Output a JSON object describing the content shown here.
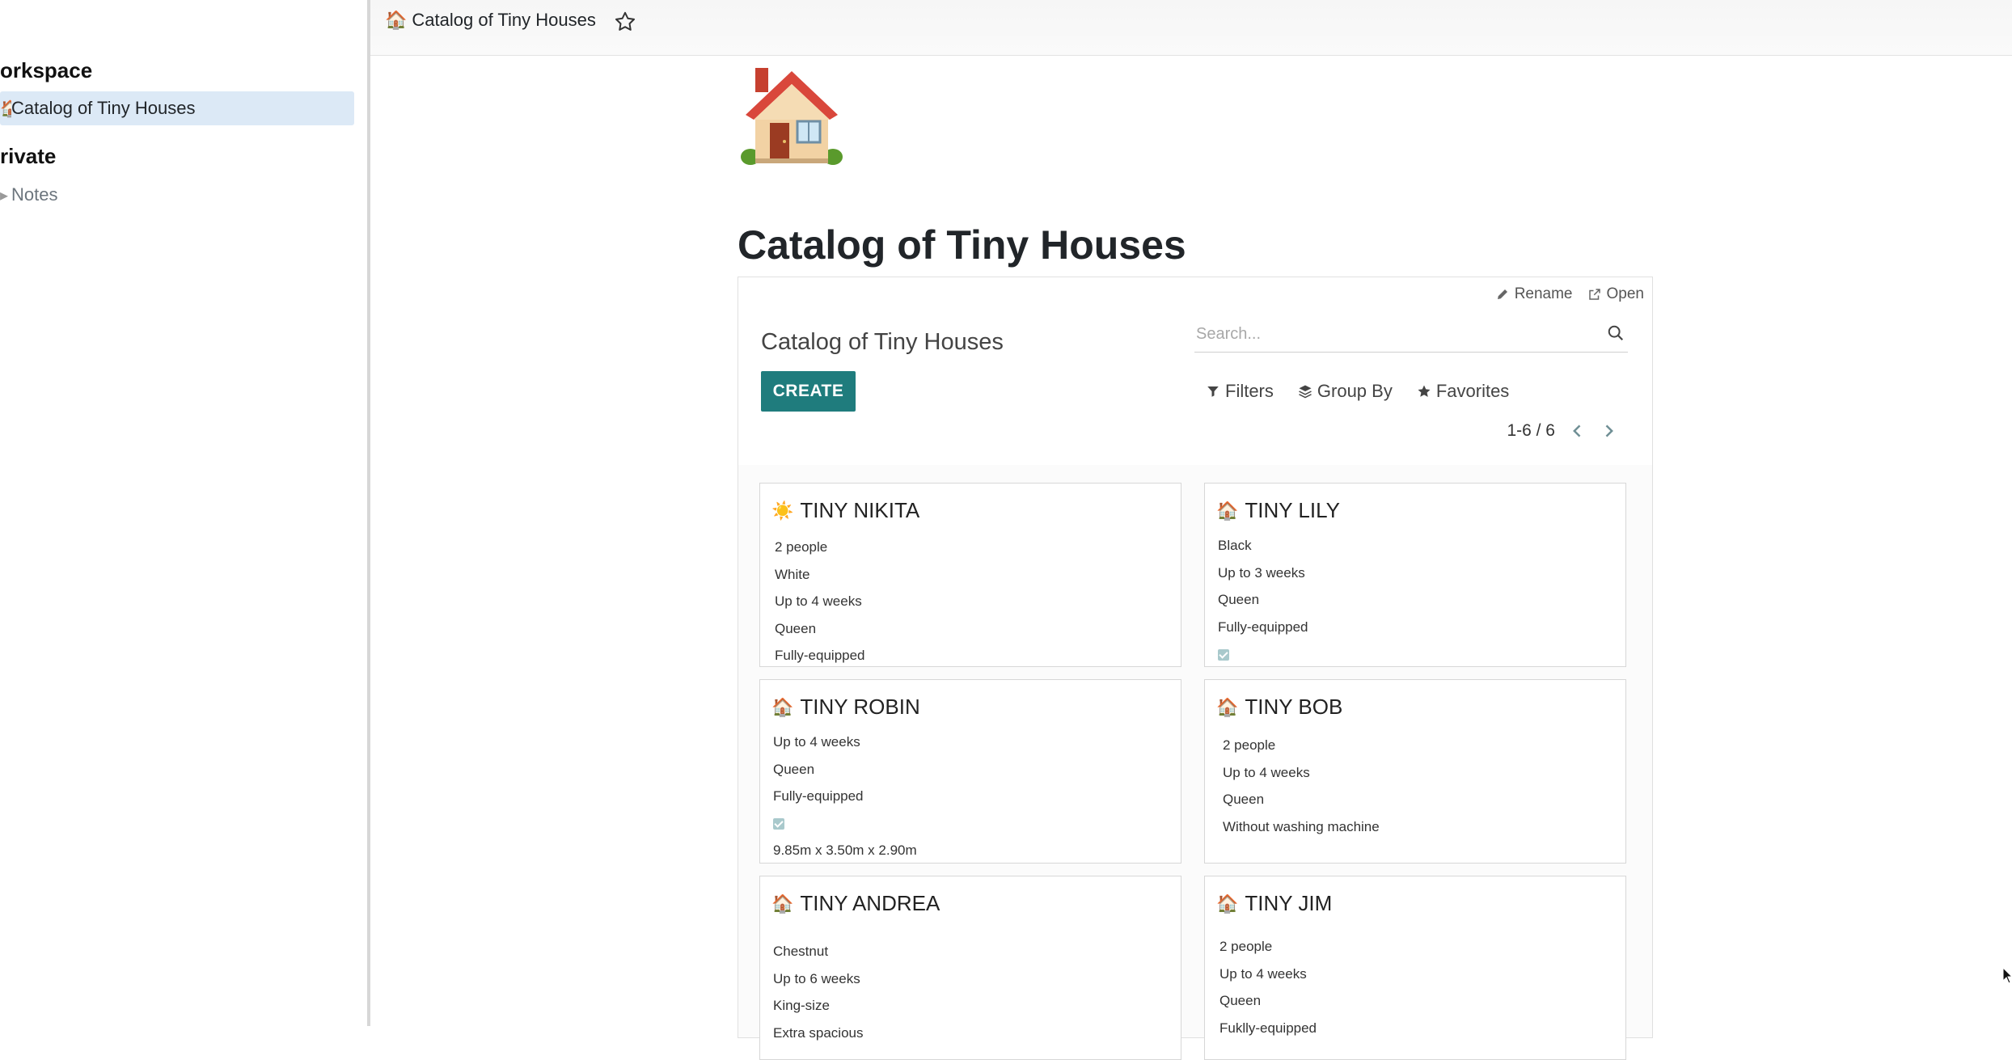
{
  "sidebar": {
    "sections": [
      {
        "heading": "orkspace",
        "items": [
          {
            "icon": "house-emoji",
            "label": "Catalog of Tiny Houses",
            "active": true
          }
        ]
      },
      {
        "heading": "rivate",
        "items": [
          {
            "icon": "notes-icon",
            "label": "Notes",
            "active": false
          }
        ]
      }
    ]
  },
  "topbar": {
    "breadcrumb": "Catalog of Tiny Houses",
    "favorite_icon": "star-outline-icon"
  },
  "page": {
    "emoji": "house-emoji",
    "title": "Catalog of Tiny Houses"
  },
  "embed": {
    "rename_label": "Rename",
    "open_label": "Open",
    "control_title": "Catalog of Tiny Houses",
    "create_label": "CREATE",
    "search_placeholder": "Search...",
    "filters_label": "Filters",
    "groupby_label": "Group By",
    "favorites_label": "Favorites",
    "pager": "1-6 / 6"
  },
  "cards": [
    {
      "emoji": "☀️",
      "title": "TINY NIKITA",
      "lines": [
        "2 people",
        "White",
        "Up to 4 weeks",
        "Queen",
        "Fully-equipped"
      ]
    },
    {
      "emoji": "🏠",
      "title": "TINY LILY",
      "lines": [
        "Black",
        "Up to 3 weeks",
        "Queen",
        "Fully-equipped",
        "[checkbox]"
      ]
    },
    {
      "emoji": "🏠",
      "title": "TINY ROBIN",
      "lines": [
        "Up to 4 weeks",
        "Queen",
        "Fully-equipped",
        "[checkbox]",
        "9.85m x 3.50m x 2.90m"
      ]
    },
    {
      "emoji": "🏠",
      "title": "TINY BOB",
      "lines": [
        "2 people",
        "Up to 4 weeks",
        "Queen",
        "Without washing machine"
      ]
    },
    {
      "emoji": "🏠",
      "title": "TINY ANDREA",
      "lines": [
        "Chestnut",
        "Up to 6 weeks",
        "King-size",
        "Extra spacious"
      ]
    },
    {
      "emoji": "🏠",
      "title": "TINY JIM",
      "lines": [
        "2 people",
        "Up to 4 weeks",
        "Queen",
        "Fuklly-equipped"
      ]
    }
  ]
}
